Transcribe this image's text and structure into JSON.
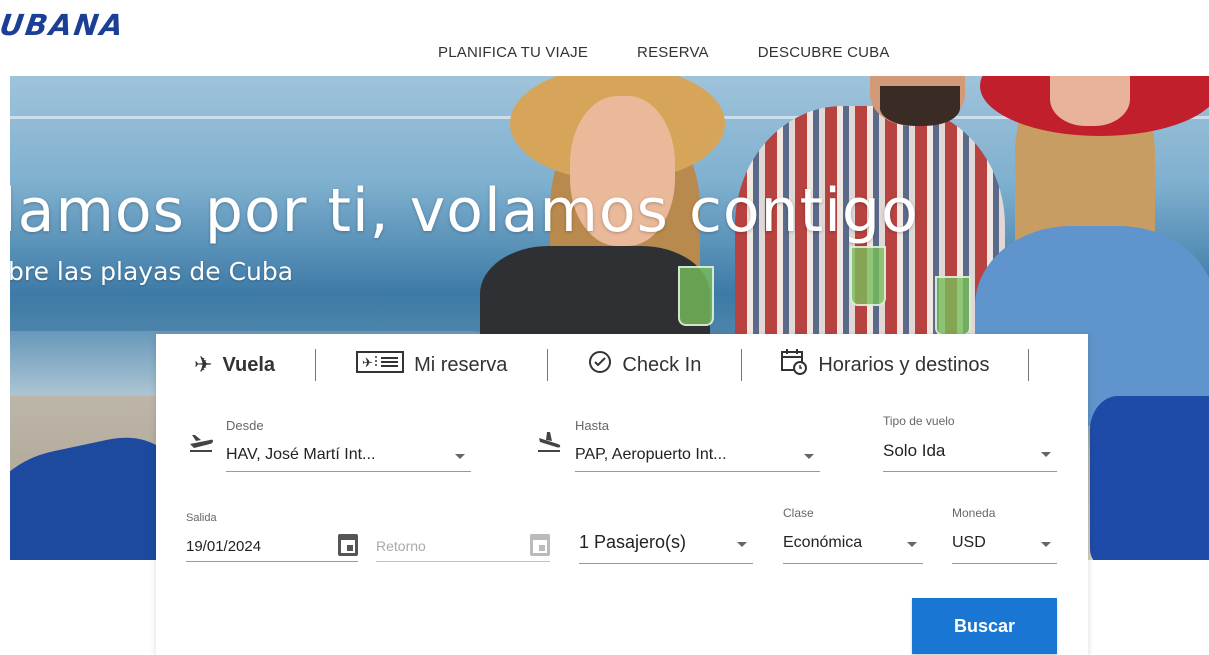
{
  "brand": {
    "logo_text": "UBANA"
  },
  "nav": {
    "items": [
      {
        "label": "PLANIFICA TU VIAJE"
      },
      {
        "label": "RESERVA"
      },
      {
        "label": "DESCUBRE CUBA"
      }
    ]
  },
  "hero": {
    "title": "lamos por ti, volamos contigo",
    "subtitle": "bre las playas de Cuba"
  },
  "booking": {
    "tabs": [
      {
        "label": "Vuela",
        "icon": "airplane-icon",
        "active": true
      },
      {
        "label": "Mi reserva",
        "icon": "boarding-pass-icon",
        "active": false
      },
      {
        "label": "Check In",
        "icon": "check-circle-icon",
        "active": false
      },
      {
        "label": "Horarios y destinos",
        "icon": "calendar-clock-icon",
        "active": false
      }
    ],
    "from": {
      "label": "Desde",
      "value": "HAV, José Martí Int..."
    },
    "to": {
      "label": "Hasta",
      "value": "PAP, Aeropuerto Int..."
    },
    "trip_type": {
      "label": "Tipo de vuelo",
      "value": "Solo Ida"
    },
    "departure": {
      "label": "Salida",
      "value": "19/01/2024"
    },
    "return": {
      "placeholder": "Retorno"
    },
    "passengers": {
      "value": "1 Pasajero(s)"
    },
    "class": {
      "label": "Clase",
      "value": "Económica"
    },
    "currency": {
      "label": "Moneda",
      "value": "USD"
    },
    "search_button": "Buscar"
  },
  "colors": {
    "brand": "#1b3f95",
    "primary_button": "#1976d2"
  }
}
